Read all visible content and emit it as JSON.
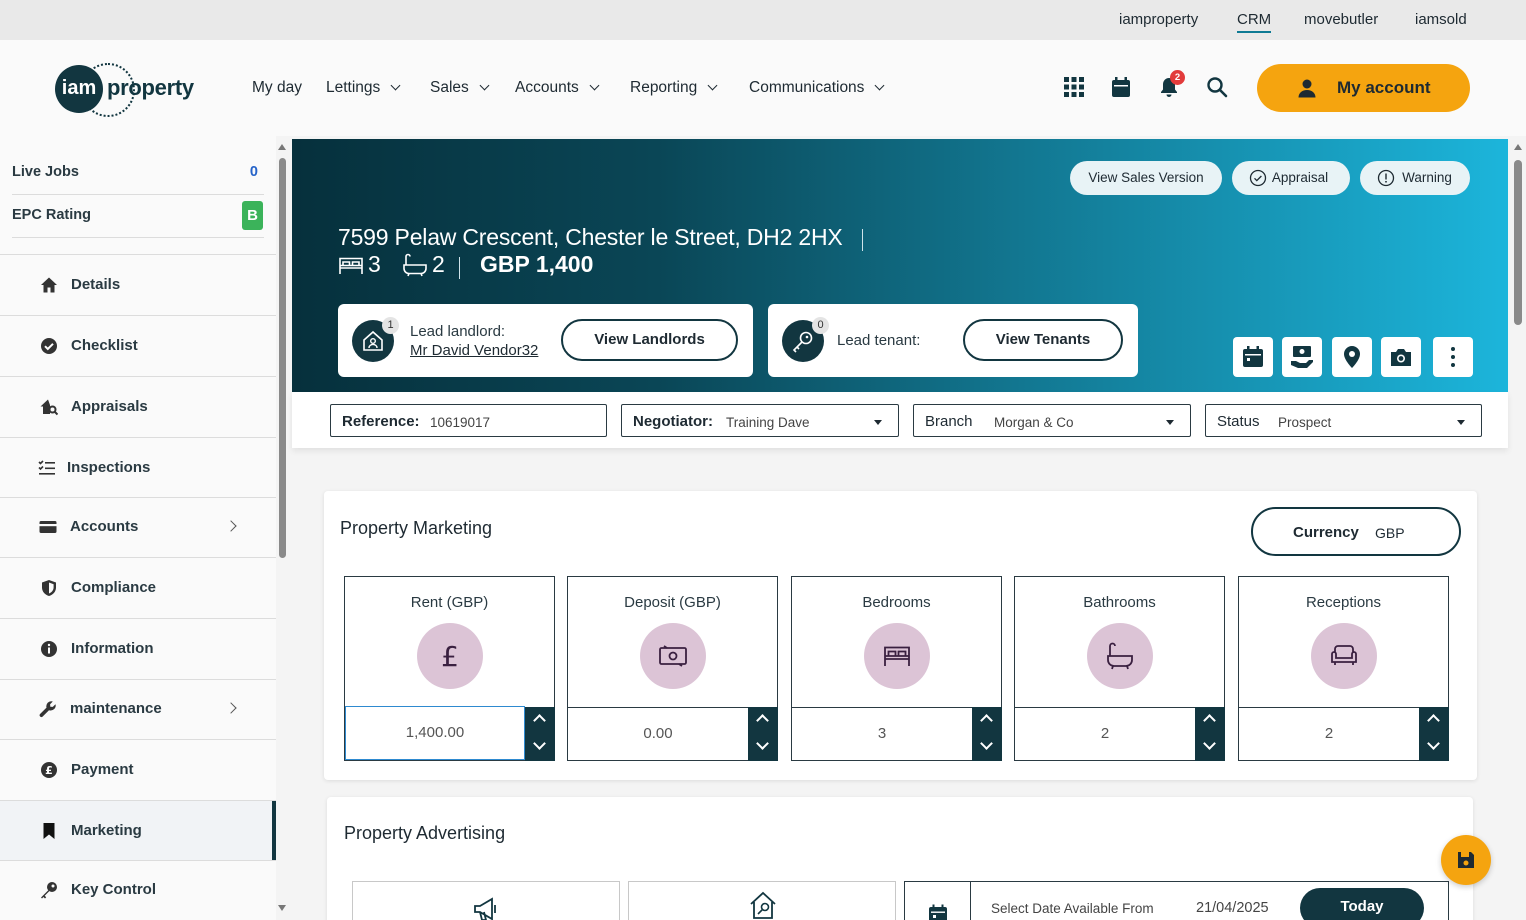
{
  "topbar": {
    "links": [
      "iamproperty",
      "CRM",
      "movebutler",
      "iamsold"
    ]
  },
  "header": {
    "logo_mark": "iam",
    "logo_text": "property",
    "nav": [
      "My day",
      "Lettings",
      "Sales",
      "Accounts",
      "Reporting",
      "Communications"
    ],
    "notifications_count": "2",
    "account_label": "My account",
    "icons": [
      "apps-grid-icon",
      "calendar-icon",
      "bell-icon",
      "search-icon",
      "user-icon"
    ]
  },
  "sidebar": {
    "live_jobs_label": "Live Jobs",
    "live_jobs_value": "0",
    "epc_label": "EPC Rating",
    "epc_value": "B",
    "epc_color": "#3bb35a",
    "items": [
      {
        "label": "Details",
        "icon": "home-icon"
      },
      {
        "label": "Checklist",
        "icon": "check-circle-icon"
      },
      {
        "label": "Appraisals",
        "icon": "house-search-icon"
      },
      {
        "label": "Inspections",
        "icon": "checklist-icon"
      },
      {
        "label": "Accounts",
        "icon": "credit-card-icon"
      },
      {
        "label": "Compliance",
        "icon": "shield-icon"
      },
      {
        "label": "Information",
        "icon": "info-icon"
      },
      {
        "label": "maintenance",
        "icon": "wrench-icon"
      },
      {
        "label": "Payment",
        "icon": "pound-coin-icon"
      },
      {
        "label": "Marketing",
        "icon": "bookmark-icon"
      },
      {
        "label": "Key Control",
        "icon": "key-icon"
      }
    ]
  },
  "hero": {
    "buttons": [
      "View Sales Version",
      "Appraisal",
      "Warning"
    ],
    "address": "7599 Pelaw Crescent, Chester le Street, DH2 2HX",
    "bedrooms": "3",
    "bathrooms": "2",
    "price": "GBP 1,400",
    "landlord": {
      "count": "1",
      "label": "Lead landlord:",
      "name": "Mr David Vendor32",
      "button": "View Landlords"
    },
    "tenant": {
      "count": "0",
      "label": "Lead tenant:",
      "button": "View Tenants"
    },
    "action_icons": [
      "calendar-icon",
      "hand-money-icon",
      "map-pin-icon",
      "camera-icon",
      "more-vertical-icon"
    ]
  },
  "filters": {
    "reference_label": "Reference:",
    "reference_value": "10619017",
    "negotiator_label": "Negotiator:",
    "negotiator_value": "Training Dave",
    "branch_label": "Branch",
    "branch_value": "Morgan & Co",
    "status_label": "Status",
    "status_value": "Prospect"
  },
  "marketing": {
    "title": "Property Marketing",
    "currency_label": "Currency",
    "currency_value": "GBP",
    "metrics": [
      {
        "label": "Rent (GBP)",
        "value": "1,400.00",
        "icon": "pound-icon"
      },
      {
        "label": "Deposit (GBP)",
        "value": "0.00",
        "icon": "banknote-icon"
      },
      {
        "label": "Bedrooms",
        "value": "3",
        "icon": "bed-icon"
      },
      {
        "label": "Bathrooms",
        "value": "2",
        "icon": "bath-icon"
      },
      {
        "label": "Receptions",
        "value": "2",
        "icon": "sofa-icon"
      }
    ]
  },
  "advertising": {
    "title": "Property Advertising",
    "date_label": "Select Date Available From",
    "date_value": "21/04/2025",
    "today_label": "Today"
  }
}
